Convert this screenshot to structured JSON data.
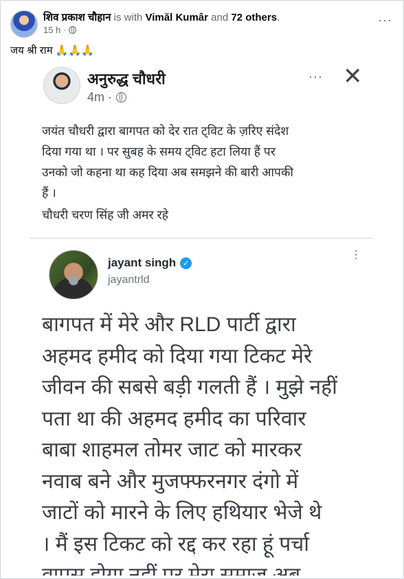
{
  "post": {
    "author": "शिव प्रकाश चौहान",
    "with_text": "is with",
    "tagged": "Vimăl Kumâr",
    "and_text": "and",
    "others": "72 others",
    "period": ".",
    "time": "15 h ·",
    "more": "···",
    "caption": "जय श्री राम 🙏🙏🙏"
  },
  "inner_post": {
    "author": "अनुरुद्ध चौधरी",
    "time": "4m ·",
    "close": "✕",
    "dots": "···",
    "lines": [
      "जयंत चौधरी द्वारा बागपत को देर रात ट्विट के ज़रिए संदेश",
      "दिया गया था । पर सुबह के समय ट्विट हटा लिया हैं पर",
      "उनको जो कहना था कह दिया अब समझने की बारी आपकी",
      "हैं ।"
    ],
    "signoff": "चौधरी चरण सिंह जी अमर रहे"
  },
  "tweet": {
    "name": "jayant singh",
    "verified_mark": "✓",
    "handle": "jayantrld",
    "dots": "⋮",
    "lines": [
      "बागपत में मेरे और RLD पार्टी द्वारा",
      "अहमद हमीद को दिया गया टिकट मेरे",
      "जीवन की सबसे बड़ी गलती हैं । मुझे नहीं",
      "पता था की अहमद हमीद का परिवार",
      "बाबा शाहमल तोमर जाट को मारकर",
      "नवाब बने और मुजफ्फरनगर दंगो में",
      "जाटों को मारने के लिए हथियार भेजे थे",
      "। मैं इस टिकट को रद्द कर रहा हूं पर्चा",
      "वापस होगा नहीं पर मेरा समाज अब"
    ]
  },
  "colors": {
    "verified": "#1d9bf0",
    "text": "#050505",
    "muted": "#65676b"
  }
}
